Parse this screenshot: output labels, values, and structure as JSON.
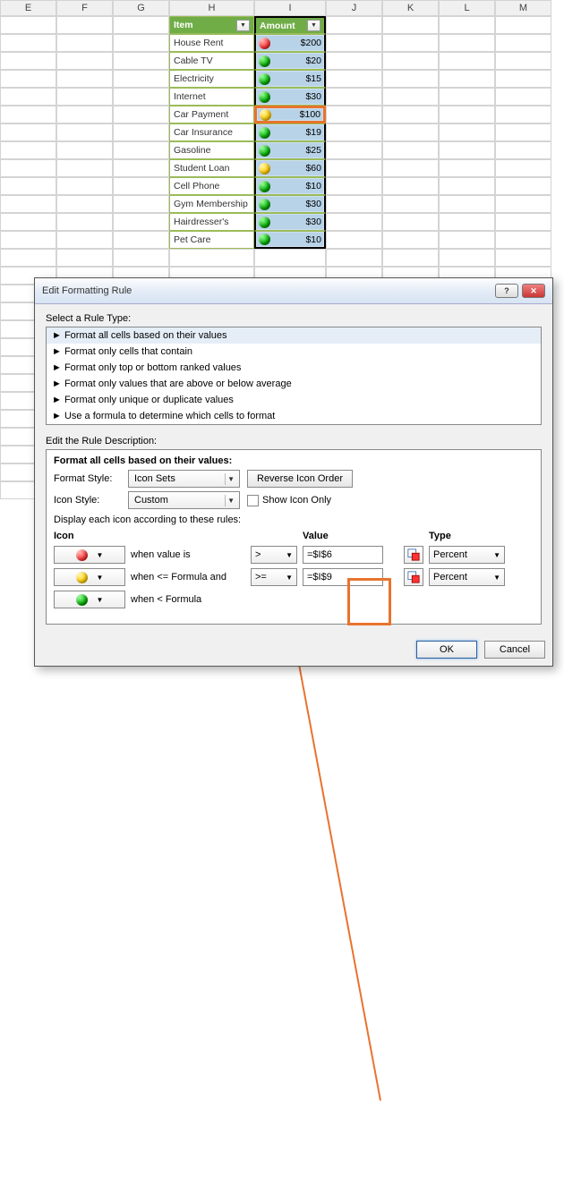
{
  "columns": [
    "E",
    "F",
    "G",
    "H",
    "I",
    "J",
    "K",
    "L",
    "M"
  ],
  "headers": {
    "item": "Item",
    "amount": "Amount"
  },
  "rows": [
    {
      "item": "House Rent",
      "dot": "red",
      "amount": "$200"
    },
    {
      "item": "Cable TV",
      "dot": "green",
      "amount": "$20"
    },
    {
      "item": "Electricity",
      "dot": "green",
      "amount": "$15"
    },
    {
      "item": "Internet",
      "dot": "green",
      "amount": "$30"
    },
    {
      "item": "Car Payment",
      "dot": "yellow",
      "amount": "$100",
      "hl": true
    },
    {
      "item": "Car Insurance",
      "dot": "green",
      "amount": "$19"
    },
    {
      "item": "Gasoline",
      "dot": "green",
      "amount": "$25"
    },
    {
      "item": "Student Loan",
      "dot": "yellow",
      "amount": "$60"
    },
    {
      "item": "Cell Phone",
      "dot": "green",
      "amount": "$10"
    },
    {
      "item": "Gym Membership",
      "dot": "green",
      "amount": "$30"
    },
    {
      "item": "Hairdresser's",
      "dot": "green",
      "amount": "$30"
    },
    {
      "item": "Pet Care",
      "dot": "green",
      "amount": "$10"
    }
  ],
  "dialog": {
    "title": "Edit Formatting Rule",
    "select_label": "Select a Rule Type:",
    "rule_types": [
      "Format all cells based on their values",
      "Format only cells that contain",
      "Format only top or bottom ranked values",
      "Format only values that are above or below average",
      "Format only unique or duplicate values",
      "Use a formula to determine which cells to format"
    ],
    "edit_label": "Edit the Rule Description:",
    "desc_header": "Format all cells based on their values:",
    "format_style_label": "Format Style:",
    "format_style_value": "Icon Sets",
    "reverse_label": "Reverse Icon Order",
    "icon_style_label": "Icon Style:",
    "icon_style_value": "Custom",
    "show_icon_only": "Show Icon Only",
    "display_label": "Display each icon according to these rules:",
    "cols": {
      "icon": "Icon",
      "value": "Value",
      "type": "Type"
    },
    "rules": [
      {
        "dot": "red",
        "when": "when value is",
        "op": ">",
        "val": "=$I$6",
        "type": "Percent"
      },
      {
        "dot": "yellow",
        "when": "when <= Formula and",
        "op": ">=",
        "val": "=$I$9",
        "type": "Percent"
      },
      {
        "dot": "green",
        "when": "when < Formula"
      }
    ],
    "ok": "OK",
    "cancel": "Cancel"
  }
}
